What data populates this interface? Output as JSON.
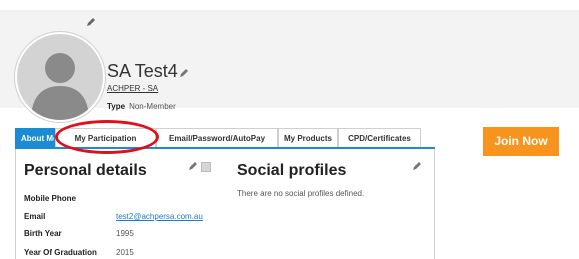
{
  "profile": {
    "name": "SA Test4",
    "organization": "ACHPER - SA",
    "type_label": "Type",
    "type_value": "Non-Member"
  },
  "tabs": [
    {
      "label": "About Me",
      "active": true
    },
    {
      "label": "My Participation",
      "active": false
    },
    {
      "label": "Email/Password/AutoPay",
      "active": false
    },
    {
      "label": "My Products",
      "active": false
    },
    {
      "label": "CPD/Certificates",
      "active": false
    }
  ],
  "join_button": "Join Now",
  "personal": {
    "heading": "Personal details",
    "fields": [
      {
        "label": "Mobile Phone",
        "value": ""
      },
      {
        "label": "Email",
        "value": "test2@achpersa.com.au",
        "link": true
      },
      {
        "label": "Birth Year",
        "value": "1995"
      },
      {
        "label": "Year Of Graduation",
        "value": "2015"
      }
    ]
  },
  "social": {
    "heading": "Social profiles",
    "empty_text": "There are no social profiles defined."
  },
  "colors": {
    "accent": "#1b8bd3",
    "join": "#f7941d",
    "highlight": "#e0101a"
  }
}
